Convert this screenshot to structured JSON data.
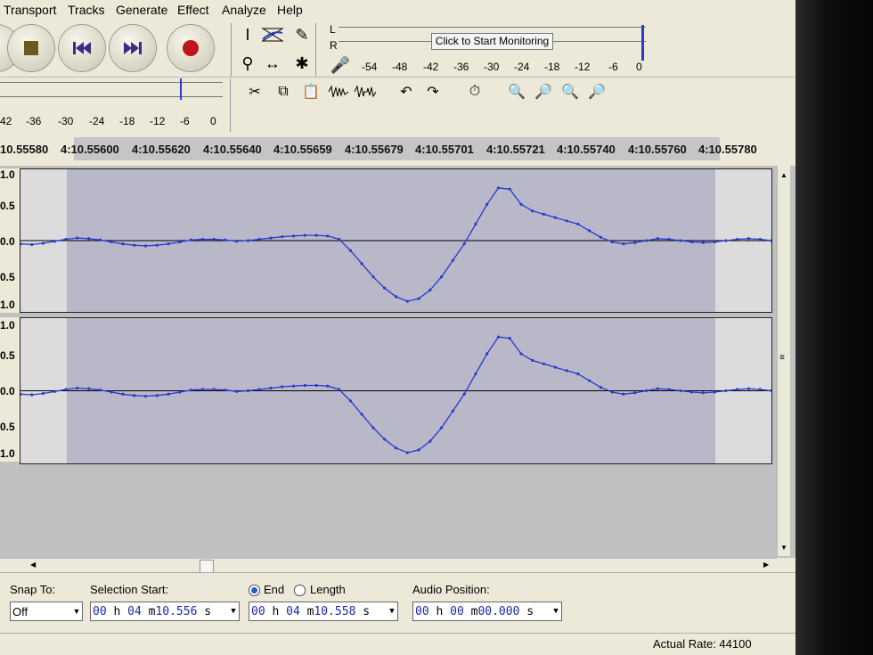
{
  "menu": {
    "items": [
      "Transport",
      "Tracks",
      "Generate",
      "Effect",
      "Analyze",
      "Help"
    ]
  },
  "meter": {
    "channel_left": "L",
    "channel_right": "R",
    "monitor_label": "Click to Start Monitoring",
    "record_scale": [
      "-54",
      "-48",
      "-42",
      "-36",
      "-30",
      "-24",
      "-18",
      "-12",
      "-6",
      "0"
    ],
    "play_scale": [
      "42",
      "-36",
      "-30",
      "-24",
      "-18",
      "-12",
      "-6",
      "0"
    ]
  },
  "timeline": {
    "ticks": [
      "10.55580",
      "4:10.55600",
      "4:10.55620",
      "4:10.55640",
      "4:10.55659",
      "4:10.55679",
      "4:10.55701",
      "4:10.55721",
      "4:10.55740",
      "4:10.55760",
      "4:10.55780"
    ]
  },
  "tracks": {
    "amplitude_labels": [
      "1.0",
      "0.5",
      "0.0",
      "0.5",
      "1.0"
    ]
  },
  "selection": {
    "snap_label": "Snap To:",
    "snap_value": "Off",
    "start_label": "Selection Start:",
    "start": {
      "h": "00",
      "m": "04",
      "s": "10.556"
    },
    "end_label": "End",
    "length_label": "Length",
    "end": {
      "h": "00",
      "m": "04",
      "s": "10.558"
    },
    "position_label": "Audio Position:",
    "position": {
      "h": "00",
      "m": "00",
      "s": "00.000"
    },
    "unit_h": "h",
    "unit_m": "m",
    "unit_s": "s"
  },
  "status": {
    "rate": "Actual Rate: 44100"
  },
  "colors": {
    "waveform": "#2a3ad0",
    "selection": "#b8b8c8",
    "background": "#ece9d8"
  }
}
